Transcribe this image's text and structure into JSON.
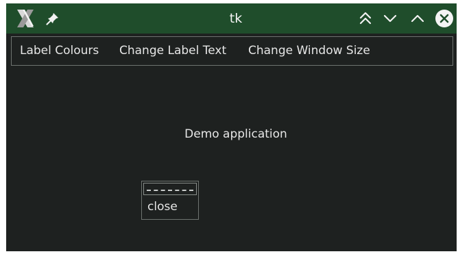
{
  "window": {
    "title": "tk",
    "icons": {
      "app": "x-window-icon",
      "pin": "pin-icon",
      "shade": "chevrons-up-icon",
      "minimize": "chevron-down-icon",
      "maximize": "chevron-up-icon",
      "close": "close-circle-icon"
    },
    "colors": {
      "titlebar": "#1f4d2b",
      "background": "#1e2120",
      "border": "#6f7471",
      "text": "#e6e6e6"
    }
  },
  "menubar": {
    "items": [
      {
        "label": "Label Colours"
      },
      {
        "label": "Change Label Text"
      },
      {
        "label": "Change Window Size"
      }
    ]
  },
  "main": {
    "label": "Demo application"
  },
  "popup_menu": {
    "tearoff": "tearoff-dashes",
    "items": [
      {
        "label": "close"
      }
    ]
  }
}
